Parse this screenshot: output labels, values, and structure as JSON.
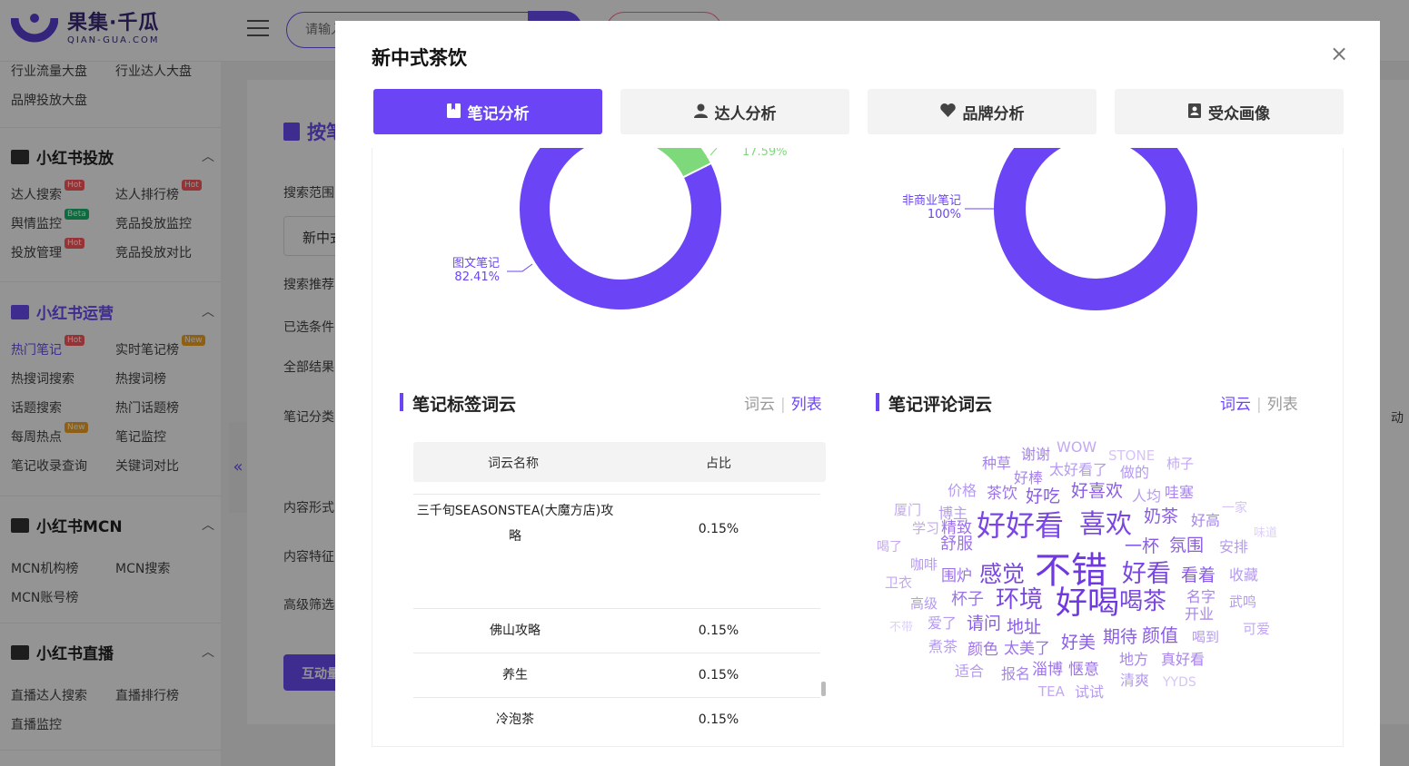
{
  "app": {
    "brand_cn": "果集·千瓜",
    "brand_en": "QIAN-GUA.COM",
    "search_placeholder": "请输入"
  },
  "sidebar": {
    "top_items": [
      "行业流量大盘",
      "行业达人大盘",
      "品牌投放大盘"
    ],
    "sections": [
      {
        "title": "小红书投放",
        "items": [
          {
            "label": "达人搜索",
            "badge": "Hot"
          },
          {
            "label": "达人排行榜",
            "badge": "Hot"
          },
          {
            "label": "舆情监控",
            "badge": "Beta"
          },
          {
            "label": "竞品投放监控",
            "badge": ""
          },
          {
            "label": "投放管理",
            "badge": "Hot"
          },
          {
            "label": "竞品投放对比",
            "badge": ""
          }
        ]
      },
      {
        "title": "小红书运营",
        "items": [
          {
            "label": "热门笔记",
            "badge": "Hot"
          },
          {
            "label": "实时笔记榜",
            "badge": "New"
          },
          {
            "label": "热搜词搜索",
            "badge": ""
          },
          {
            "label": "热搜词榜",
            "badge": ""
          },
          {
            "label": "话题搜索",
            "badge": ""
          },
          {
            "label": "热门话题榜",
            "badge": ""
          },
          {
            "label": "每周热点",
            "badge": "New"
          },
          {
            "label": "笔记监控",
            "badge": ""
          },
          {
            "label": "笔记收录查询",
            "badge": ""
          },
          {
            "label": "关键词对比",
            "badge": ""
          }
        ]
      },
      {
        "title": "小红书MCN",
        "items": [
          {
            "label": "MCN机构榜",
            "badge": ""
          },
          {
            "label": "MCN搜索",
            "badge": ""
          },
          {
            "label": "MCN账号榜",
            "badge": ""
          }
        ]
      },
      {
        "title": "小红书直播",
        "items": [
          {
            "label": "直播达人搜索",
            "badge": ""
          },
          {
            "label": "直播排行榜",
            "badge": ""
          },
          {
            "label": "直播监控",
            "badge": ""
          }
        ]
      }
    ],
    "collapse_icon": "«"
  },
  "background_page": {
    "title_partial": "按笔",
    "labels": [
      "搜索范围",
      "搜索推荐",
      "已选条件",
      "全部结果",
      "笔记分类",
      "内容形式",
      "内容特征",
      "高级筛选"
    ],
    "input_value": "新中式",
    "button_partial": "互动量",
    "right_partial": "动"
  },
  "modal": {
    "title": "新中式茶饮",
    "close_icon": "×",
    "tabs": [
      {
        "label": "笔记分析",
        "icon": "note-icon",
        "active": true
      },
      {
        "label": "达人分析",
        "icon": "user-icon",
        "active": false
      },
      {
        "label": "品牌分析",
        "icon": "heart-icon",
        "active": false
      },
      {
        "label": "受众画像",
        "icon": "audience-icon",
        "active": false
      }
    ],
    "donut_left": {
      "slices": [
        {
          "name": "图文笔记",
          "percent": 82.41,
          "label": "82.41%",
          "color": "#6b45f5"
        },
        {
          "name": "",
          "percent": 17.59,
          "label": "17.59%",
          "color": "#7ed97a"
        }
      ]
    },
    "donut_right": {
      "slices": [
        {
          "name": "非商业笔记",
          "percent": 100,
          "label": "100%",
          "color": "#6b45f5"
        }
      ]
    },
    "tag_cloud_section": {
      "title": "笔记标签词云",
      "toggle_cloud": "词云",
      "toggle_list": "列表",
      "active": "列表",
      "table": {
        "headers": [
          "词云名称",
          "占比"
        ],
        "rows": [
          {
            "name": "三千旬SEASONSTEA(大魔方店)攻略",
            "percent": "0.15%"
          },
          {
            "name": "佛山攻略",
            "percent": "0.15%"
          },
          {
            "name": "养生",
            "percent": "0.15%"
          },
          {
            "name": "冷泡茶",
            "percent": "0.15%"
          }
        ]
      }
    },
    "comment_cloud_section": {
      "title": "笔记评论词云",
      "toggle_cloud": "词云",
      "toggle_list": "列表",
      "active": "词云",
      "words": [
        "WOW",
        "谢谢",
        "STONE",
        "种草",
        "柿子",
        "好棒",
        "太好看了",
        "做的",
        "价格",
        "茶饮",
        "好吃",
        "好喜欢",
        "人均",
        "哇塞",
        "厦门",
        "一家",
        "博主",
        "奶茶",
        "好高",
        "学习",
        "精致",
        "好好看",
        "喜欢",
        "味道",
        "喝了",
        "舒服",
        "一杯",
        "氛围",
        "安排",
        "咖啡",
        "卫衣",
        "围炉",
        "感觉",
        "不错",
        "好看",
        "看着",
        "收藏",
        "高级",
        "杯子",
        "环境",
        "好喝",
        "喝茶",
        "名字",
        "武鸣",
        "开业",
        "不带",
        "爱了",
        "请问",
        "地址",
        "可爱",
        "煮茶",
        "颜色",
        "太美了",
        "好美",
        "期待",
        "颜值",
        "喝到",
        "适合",
        "报名",
        "淄博",
        "惬意",
        "地方",
        "真好看",
        "TEA",
        "试试",
        "清爽",
        "YYDS"
      ]
    }
  }
}
